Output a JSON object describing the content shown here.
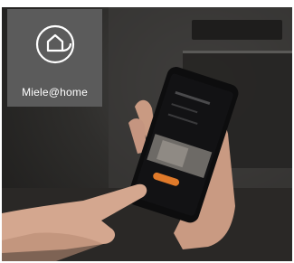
{
  "badge": {
    "label": "Miele@home",
    "icon": "home-at-icon",
    "background_color": "#5b5b5b"
  },
  "photo": {
    "subject": "hand-tapping-smartphone-icon"
  }
}
